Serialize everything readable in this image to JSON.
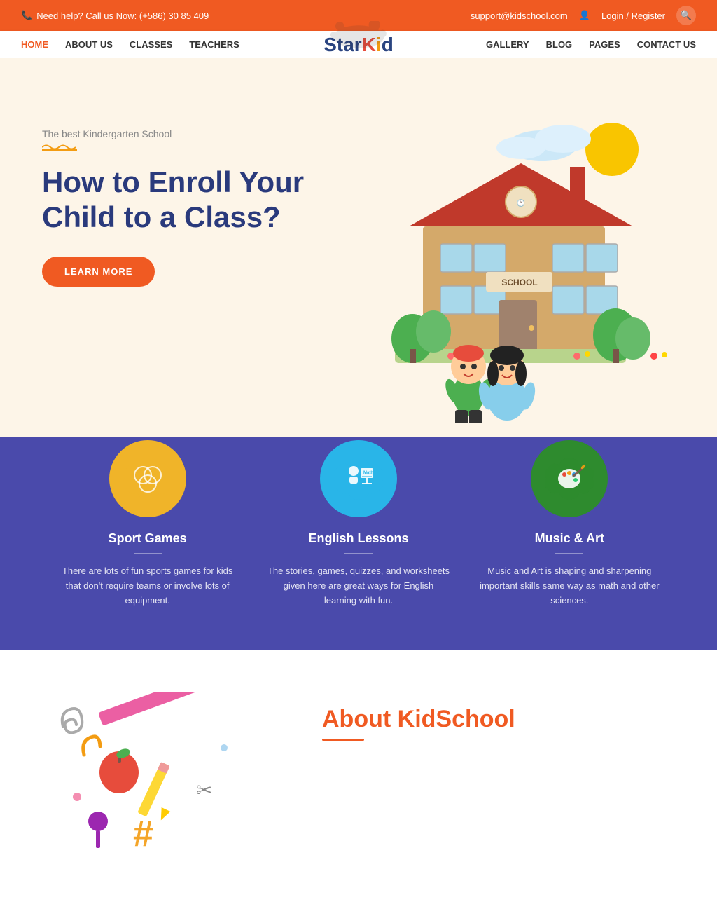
{
  "topbar": {
    "phone_icon": "📞",
    "phone_text": "Need help? Call us Now: (+586) 30 85 409",
    "email": "support@kidschool.com",
    "login_text": "Login / Register",
    "user_icon": "👤",
    "search_icon": "🔍"
  },
  "nav": {
    "left_links": [
      {
        "label": "HOME",
        "active": true
      },
      {
        "label": "ABOUT US",
        "active": false
      },
      {
        "label": "CLASSES",
        "active": false
      },
      {
        "label": "TEACHERS",
        "active": false
      }
    ],
    "logo_text": "StarKid",
    "right_links": [
      {
        "label": "GALLERY",
        "active": false
      },
      {
        "label": "BLOG",
        "active": false
      },
      {
        "label": "PAGES",
        "active": false
      },
      {
        "label": "CONTACT US",
        "active": false
      }
    ]
  },
  "hero": {
    "subtitle": "The best Kindergarten School",
    "title": "How to Enroll Your Child to a Class?",
    "button_label": "LEARN MORE"
  },
  "features": {
    "items": [
      {
        "title": "Sport Games",
        "description": "There are lots of fun sports games for kids that don't require teams or involve lots of equipment.",
        "icon_color": "sport",
        "icon_symbol": "⊙"
      },
      {
        "title": "English Lessons",
        "description": "The stories, games, quizzes, and worksheets given here are great ways for English learning with fun.",
        "icon_color": "english",
        "icon_symbol": "🎓"
      },
      {
        "title": "Music & Art",
        "description": "Music and Art is shaping and sharpening important skills same way as math and other sciences.",
        "icon_color": "music",
        "icon_symbol": "🎨"
      }
    ]
  },
  "about": {
    "title_prefix": "About ",
    "title_highlight": "KidSchool"
  }
}
